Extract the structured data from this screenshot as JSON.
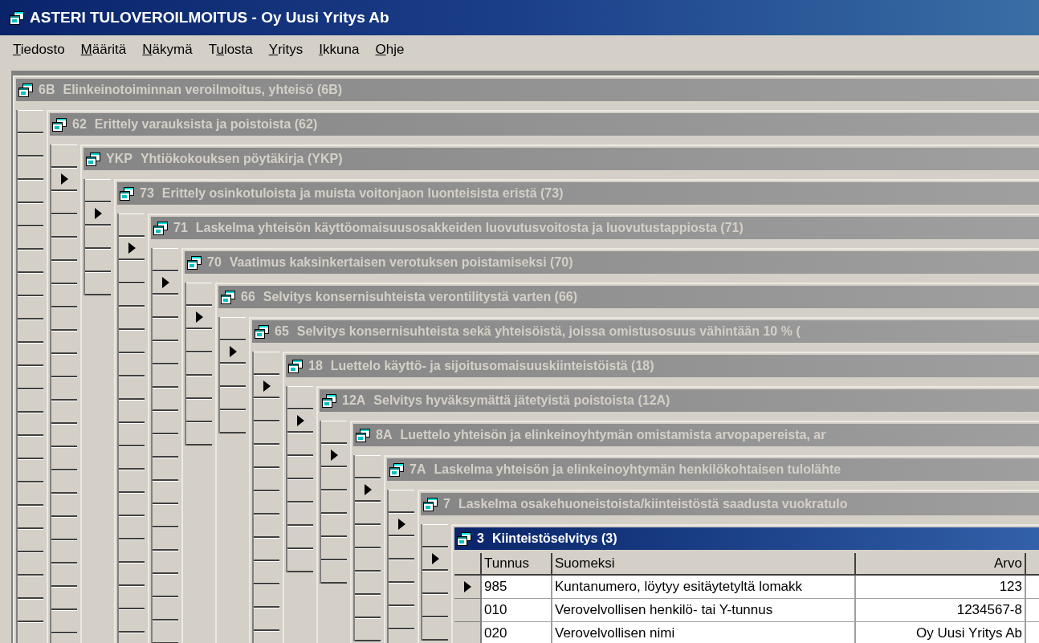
{
  "app": {
    "title": "ASTERI TULOVEROILMOITUS - Oy Uusi Yritys Ab"
  },
  "menu": [
    {
      "key": "T",
      "post": "iedosto"
    },
    {
      "key": "M",
      "post": "ääritä"
    },
    {
      "key": "N",
      "post": "äkymä"
    },
    {
      "pre": "T",
      "key": "u",
      "post": "losta"
    },
    {
      "key": "Y",
      "post": "ritys"
    },
    {
      "key": "I",
      "post": "kkuna"
    },
    {
      "key": "O",
      "post": "hje"
    }
  ],
  "windows": [
    {
      "code": "6B",
      "name": "Elinkeinotoiminnan veroilmoitus, yhteisö (6B)",
      "active": false,
      "rows": [
        {
          "current": false
        },
        {
          "current": false
        },
        {
          "current": false
        },
        {
          "current": false
        },
        {
          "current": false
        },
        {
          "current": false
        },
        {
          "current": false
        },
        {
          "current": false
        },
        {
          "current": false
        },
        {
          "current": false
        },
        {
          "current": false
        },
        {
          "current": false
        },
        {
          "current": false
        },
        {
          "current": false
        },
        {
          "current": false
        },
        {
          "current": false
        },
        {
          "current": false
        },
        {
          "current": false
        },
        {
          "current": false
        },
        {
          "current": false
        },
        {
          "current": false
        },
        {
          "current": false
        }
      ]
    },
    {
      "code": "62",
      "name": "Erittely varauksista ja poistoista (62)",
      "active": false,
      "rows": [
        {
          "current": true
        },
        {
          "current": false
        },
        {
          "current": false
        },
        {
          "current": false
        },
        {
          "current": false
        },
        {
          "current": false
        },
        {
          "current": false
        },
        {
          "current": false
        },
        {
          "current": false
        },
        {
          "current": false
        },
        {
          "current": false
        },
        {
          "current": false
        },
        {
          "current": false
        },
        {
          "current": false
        },
        {
          "current": false
        },
        {
          "current": false
        },
        {
          "current": false
        },
        {
          "current": false
        },
        {
          "current": false
        },
        {
          "current": false
        },
        {
          "current": false
        }
      ]
    },
    {
      "code": "YKP",
      "name": "Yhtiökokouksen pöytäkirja (YKP)",
      "active": false,
      "rows": [
        {
          "current": true
        },
        {
          "current": false
        },
        {
          "current": false
        },
        {
          "current": false
        }
      ]
    },
    {
      "code": "73",
      "name": "Erittely osinkotuloista ja muista voitonjaon luonteisista eristä (73)",
      "active": false,
      "rows": [
        {
          "current": true
        },
        {
          "current": false
        },
        {
          "current": false
        },
        {
          "current": false
        },
        {
          "current": false
        },
        {
          "current": false
        },
        {
          "current": false
        },
        {
          "current": false
        },
        {
          "current": false
        },
        {
          "current": false
        },
        {
          "current": false
        },
        {
          "current": false
        },
        {
          "current": false
        },
        {
          "current": false
        },
        {
          "current": false
        },
        {
          "current": false
        },
        {
          "current": false
        },
        {
          "current": false
        }
      ]
    },
    {
      "code": "71",
      "name": "Laskelma yhteisön käyttöomaisuusosakkeiden luovutusvoitosta ja luovutustappiosta (71)",
      "active": false,
      "rows": [
        {
          "current": true
        },
        {
          "current": false
        },
        {
          "current": false
        },
        {
          "current": false
        },
        {
          "current": false
        },
        {
          "current": false
        },
        {
          "current": false
        },
        {
          "current": false
        },
        {
          "current": false
        },
        {
          "current": false
        },
        {
          "current": false
        },
        {
          "current": false
        },
        {
          "current": false
        },
        {
          "current": false
        },
        {
          "current": false
        },
        {
          "current": false
        }
      ]
    },
    {
      "code": "70",
      "name": "Vaatimus kaksinkertaisen verotuksen poistamiseksi (70)",
      "active": false,
      "rows": [
        {
          "current": true
        },
        {
          "current": false
        },
        {
          "current": false
        },
        {
          "current": false
        },
        {
          "current": false
        },
        {
          "current": false
        }
      ]
    },
    {
      "code": "66",
      "name": "Selvitys konsernisuhteista verontilitystä varten (66)",
      "active": false,
      "rows": [
        {
          "current": true
        },
        {
          "current": false
        },
        {
          "current": false
        },
        {
          "current": false
        }
      ]
    },
    {
      "code": "65",
      "name": "Selvitys konsernisuhteista sekä yhteisöistä, joissa omistusosuus vähintään 10 % (",
      "active": false,
      "rows": [
        {
          "current": true
        },
        {
          "current": false
        },
        {
          "current": false
        },
        {
          "current": false
        },
        {
          "current": false
        },
        {
          "current": false
        },
        {
          "current": false
        },
        {
          "current": false
        },
        {
          "current": false
        },
        {
          "current": false
        },
        {
          "current": false
        },
        {
          "current": false
        }
      ]
    },
    {
      "code": "18",
      "name": "Luettelo käyttö- ja sijoitusomaisuuskiinteistöistä (18)",
      "active": false,
      "rows": [
        {
          "current": true
        },
        {
          "current": false
        },
        {
          "current": false
        },
        {
          "current": false
        },
        {
          "current": false
        },
        {
          "current": false
        },
        {
          "current": false
        }
      ]
    },
    {
      "code": "12A",
      "name": "Selvitys hyväksymättä jätetyistä poistoista (12A)",
      "active": false,
      "rows": [
        {
          "current": true
        },
        {
          "current": false
        },
        {
          "current": false
        },
        {
          "current": false
        },
        {
          "current": false
        },
        {
          "current": false
        }
      ]
    },
    {
      "code": "8A",
      "name": "Luettelo yhteisön ja elinkeinoyhtymän omistamista arvopapereista, ar",
      "active": false,
      "rows": [
        {
          "current": true
        },
        {
          "current": false
        },
        {
          "current": false
        },
        {
          "current": false
        },
        {
          "current": false
        },
        {
          "current": false
        },
        {
          "current": false
        }
      ]
    },
    {
      "code": "7A",
      "name": "Laskelma yhteisön ja elinkeinoyhtymän henkilökohtaisen tulolähte",
      "active": false,
      "rows": [
        {
          "current": true
        },
        {
          "current": false
        },
        {
          "current": false
        },
        {
          "current": false
        },
        {
          "current": false
        },
        {
          "current": false
        }
      ]
    },
    {
      "code": "7",
      "name": "Laskelma osakehuoneistoista/kiinteistöstä saadusta vuokratulo",
      "active": false,
      "rows": [
        {
          "current": true
        },
        {
          "current": false
        },
        {
          "current": false
        },
        {
          "current": false
        }
      ]
    },
    {
      "code": "3",
      "name": "Kiinteistöselvitys (3)",
      "active": true,
      "table": {
        "columns": [
          "Tunnus",
          "Suomeksi",
          "Arvo"
        ],
        "rows": [
          {
            "selected": true,
            "cells": [
              "985",
              "Kuntanumero, löytyy esitäytetyltä lomakk",
              "123"
            ]
          },
          {
            "selected": false,
            "cells": [
              "010",
              "Verovelvollisen henkilö- tai Y-tunnus",
              "1234567-8"
            ]
          },
          {
            "selected": false,
            "cells": [
              "020",
              "Verovelvollisen nimi",
              "Oy Uusi Yritys Ab"
            ]
          }
        ]
      }
    }
  ]
}
